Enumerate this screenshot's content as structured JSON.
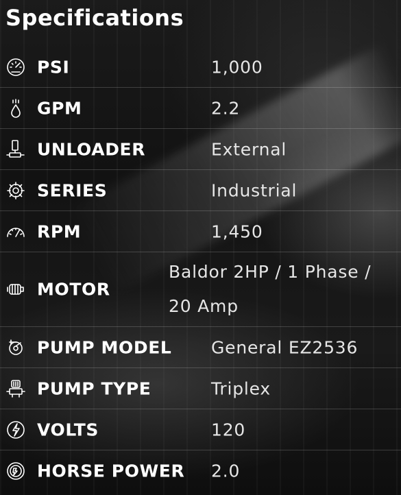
{
  "title": "Specifications",
  "specs": [
    {
      "label": "PSI",
      "value": "1,000",
      "icon": "pressure-gauge-icon"
    },
    {
      "label": "GPM",
      "value": "2.2",
      "icon": "water-drop-icon"
    },
    {
      "label": "UNLOADER",
      "value": "External",
      "icon": "unloader-valve-icon"
    },
    {
      "label": "SERIES",
      "value": "Industrial",
      "icon": "gear-icon"
    },
    {
      "label": "RPM",
      "value": "1,450",
      "icon": "speedometer-icon"
    },
    {
      "label": "MOTOR",
      "value": "Baldor 2HP / 1 Phase / 20 Amp",
      "icon": "motor-icon"
    },
    {
      "label": "PUMP MODEL",
      "value": "General EZ2536",
      "icon": "pump-icon"
    },
    {
      "label": "PUMP TYPE",
      "value": "Triplex",
      "icon": "triplex-pump-icon"
    },
    {
      "label": "VOLTS",
      "value": "120",
      "icon": "lightning-bolt-icon"
    },
    {
      "label": "HORSE POWER",
      "value": "2.0",
      "icon": "horsepower-icon"
    }
  ]
}
